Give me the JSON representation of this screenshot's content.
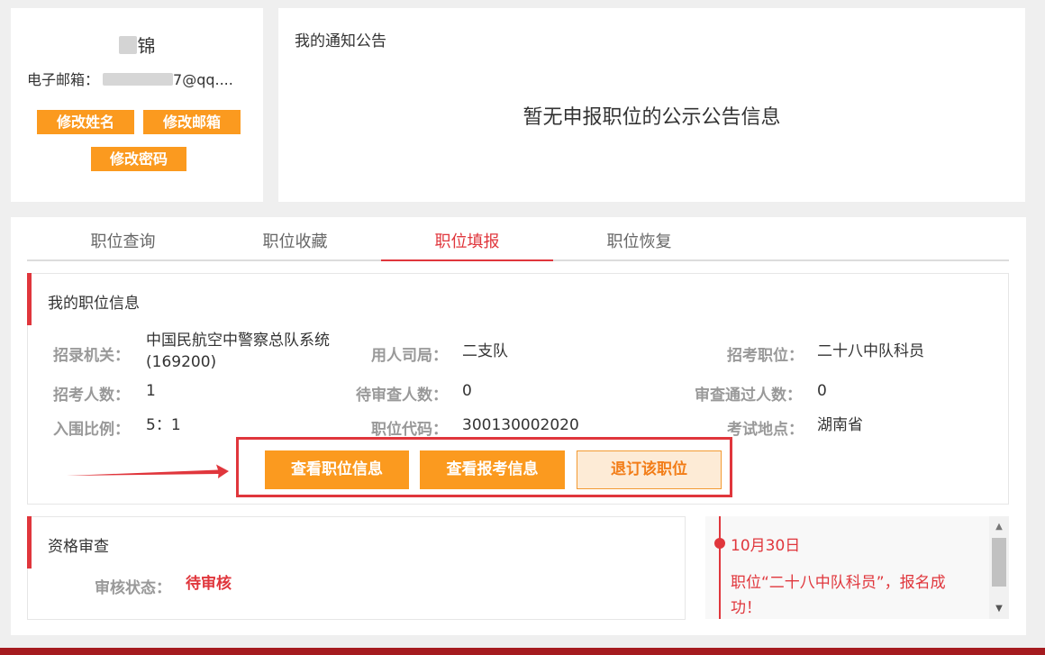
{
  "profile": {
    "name_suffix": "锦",
    "email_label": "电子邮箱：",
    "email_suffix": "7@qq....",
    "buttons": {
      "edit_name": "修改姓名",
      "edit_email": "修改邮箱",
      "edit_password": "修改密码"
    }
  },
  "notice": {
    "title": "我的通知公告",
    "empty_message": "暂无申报职位的公示公告信息"
  },
  "tabs": [
    {
      "label": "职位查询"
    },
    {
      "label": "职位收藏"
    },
    {
      "label": "职位填报"
    },
    {
      "label": "职位恢复"
    }
  ],
  "position_info": {
    "title": "我的职位信息",
    "agency_label": "招录机关：",
    "agency_value": "中国民航空中警察总队系统",
    "agency_code": "(169200)",
    "employer_label": "用人司局：",
    "employer_value": "二支队",
    "job_label": "招考职位：",
    "job_value": "二十八中队科员",
    "count_label": "招考人数：",
    "count_value": "1",
    "pending_label": "待审查人数：",
    "pending_value": "0",
    "passed_label": "审查通过人数：",
    "passed_value": "0",
    "ratio_label": "入围比例：",
    "ratio_value": "5：1",
    "code_label": "职位代码：",
    "code_value": "300130002020",
    "location_label": "考试地点：",
    "location_value": "湖南省",
    "buttons": {
      "view_position": "查看职位信息",
      "view_application": "查看报考信息",
      "withdraw": "退订该职位"
    }
  },
  "qualification": {
    "title": "资格审查",
    "status_label": "审核状态：",
    "status_value": "待审核"
  },
  "timeline": {
    "date": "10月30日",
    "message": "职位“二十八中队科员”，报名成功！"
  },
  "colors": {
    "accent_red": "#e0363c",
    "orange": "#fb9a1f",
    "footer": "#a51b1f"
  }
}
